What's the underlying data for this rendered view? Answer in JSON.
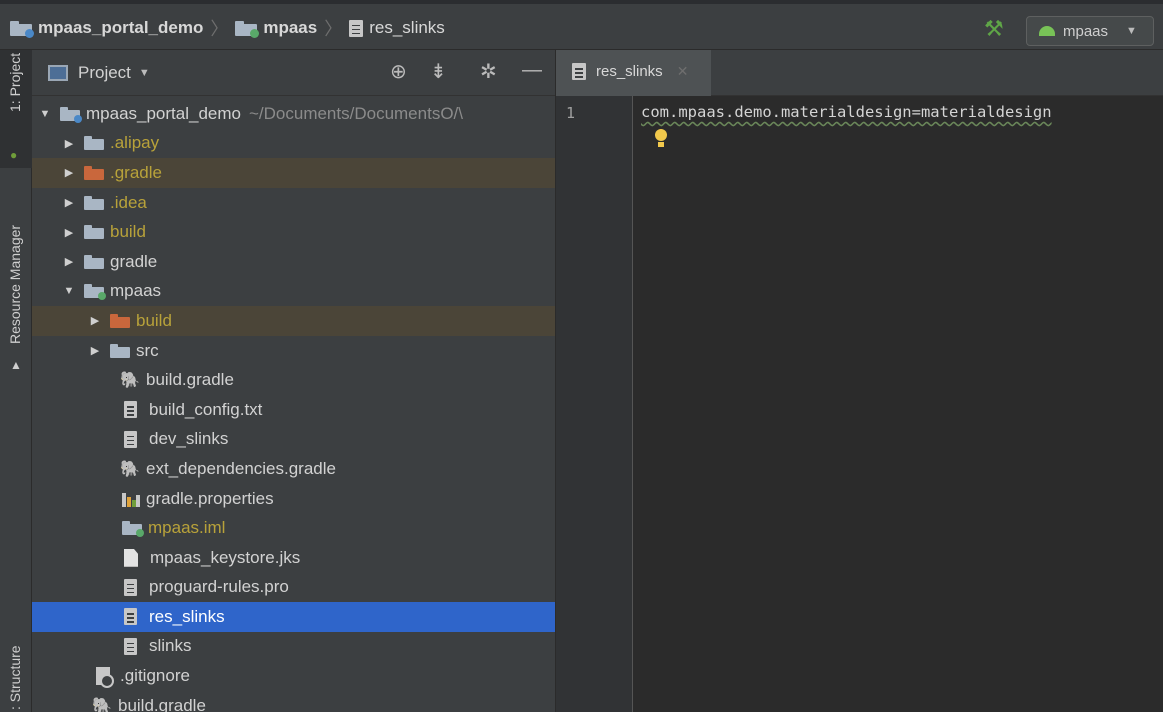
{
  "breadcrumb": {
    "items": [
      {
        "label": "mpaas_portal_demo",
        "type": "project"
      },
      {
        "label": "mpaas",
        "type": "module"
      },
      {
        "label": "res_slinks",
        "type": "file"
      }
    ]
  },
  "toolbar": {
    "build_icon": "hammer-icon",
    "run_config": "mpaas"
  },
  "tool_strip": {
    "project_tab": "1: Project",
    "resource_manager_tab": "Resource Manager",
    "structure_tab": ": Structure"
  },
  "project_panel": {
    "view_selector": "Project",
    "tools": [
      "locate-icon",
      "collapse-icon",
      "gear-icon",
      "minimize-icon"
    ],
    "tree": [
      {
        "label": "mpaas_portal_demo",
        "suffix": "~/Documents/DocumentsO/\\",
        "depth": 0,
        "arrow": "open",
        "icon": "project-folder",
        "color": "default"
      },
      {
        "label": ".alipay",
        "depth": 1,
        "arrow": "closed",
        "icon": "folder",
        "color": "yellow"
      },
      {
        "label": ".gradle",
        "depth": 1,
        "arrow": "closed",
        "icon": "folder-excluded",
        "color": "yellow",
        "highlight": true
      },
      {
        "label": ".idea",
        "depth": 1,
        "arrow": "closed",
        "icon": "folder",
        "color": "yellow"
      },
      {
        "label": "build",
        "depth": 1,
        "arrow": "closed",
        "icon": "folder",
        "color": "yellow"
      },
      {
        "label": "gradle",
        "depth": 1,
        "arrow": "closed",
        "icon": "folder",
        "color": "default"
      },
      {
        "label": "mpaas",
        "depth": 1,
        "arrow": "open",
        "icon": "module-folder",
        "color": "default"
      },
      {
        "label": "build",
        "depth": 2,
        "arrow": "closed",
        "icon": "folder-excluded",
        "color": "yellow",
        "highlight": true
      },
      {
        "label": "src",
        "depth": 2,
        "arrow": "closed",
        "icon": "folder",
        "color": "default"
      },
      {
        "label": "build.gradle",
        "depth": 2,
        "icon": "gradle",
        "color": "default"
      },
      {
        "label": "build_config.txt",
        "depth": 2,
        "icon": "text-file",
        "color": "default"
      },
      {
        "label": "dev_slinks",
        "depth": 2,
        "icon": "text-file",
        "color": "default"
      },
      {
        "label": "ext_dependencies.gradle",
        "depth": 2,
        "icon": "gradle",
        "color": "default"
      },
      {
        "label": "gradle.properties",
        "depth": 2,
        "icon": "properties",
        "color": "default"
      },
      {
        "label": "mpaas.iml",
        "depth": 2,
        "icon": "module-folder",
        "color": "yellow"
      },
      {
        "label": "mpaas_keystore.jks",
        "depth": 2,
        "icon": "blank-file",
        "color": "default"
      },
      {
        "label": "proguard-rules.pro",
        "depth": 2,
        "icon": "text-file",
        "color": "default"
      },
      {
        "label": "res_slinks",
        "depth": 2,
        "icon": "text-file",
        "color": "default",
        "selected": true
      },
      {
        "label": "slinks",
        "depth": 2,
        "icon": "text-file",
        "color": "default"
      },
      {
        "label": ".gitignore",
        "depth": 1,
        "icon": "gitignore",
        "color": "default"
      },
      {
        "label": "build.gradle",
        "depth": 1,
        "icon": "gradle",
        "color": "default"
      }
    ]
  },
  "editor": {
    "tab_label": "res_slinks",
    "line_number": "1",
    "code": "com.mpaas.demo.materialdesign=materialdesign"
  },
  "colors": {
    "selection": "#2f65ca",
    "excluded_highlight": "#4b4538",
    "ignored_text": "#b8a23a",
    "build_green": "#5fa547"
  }
}
